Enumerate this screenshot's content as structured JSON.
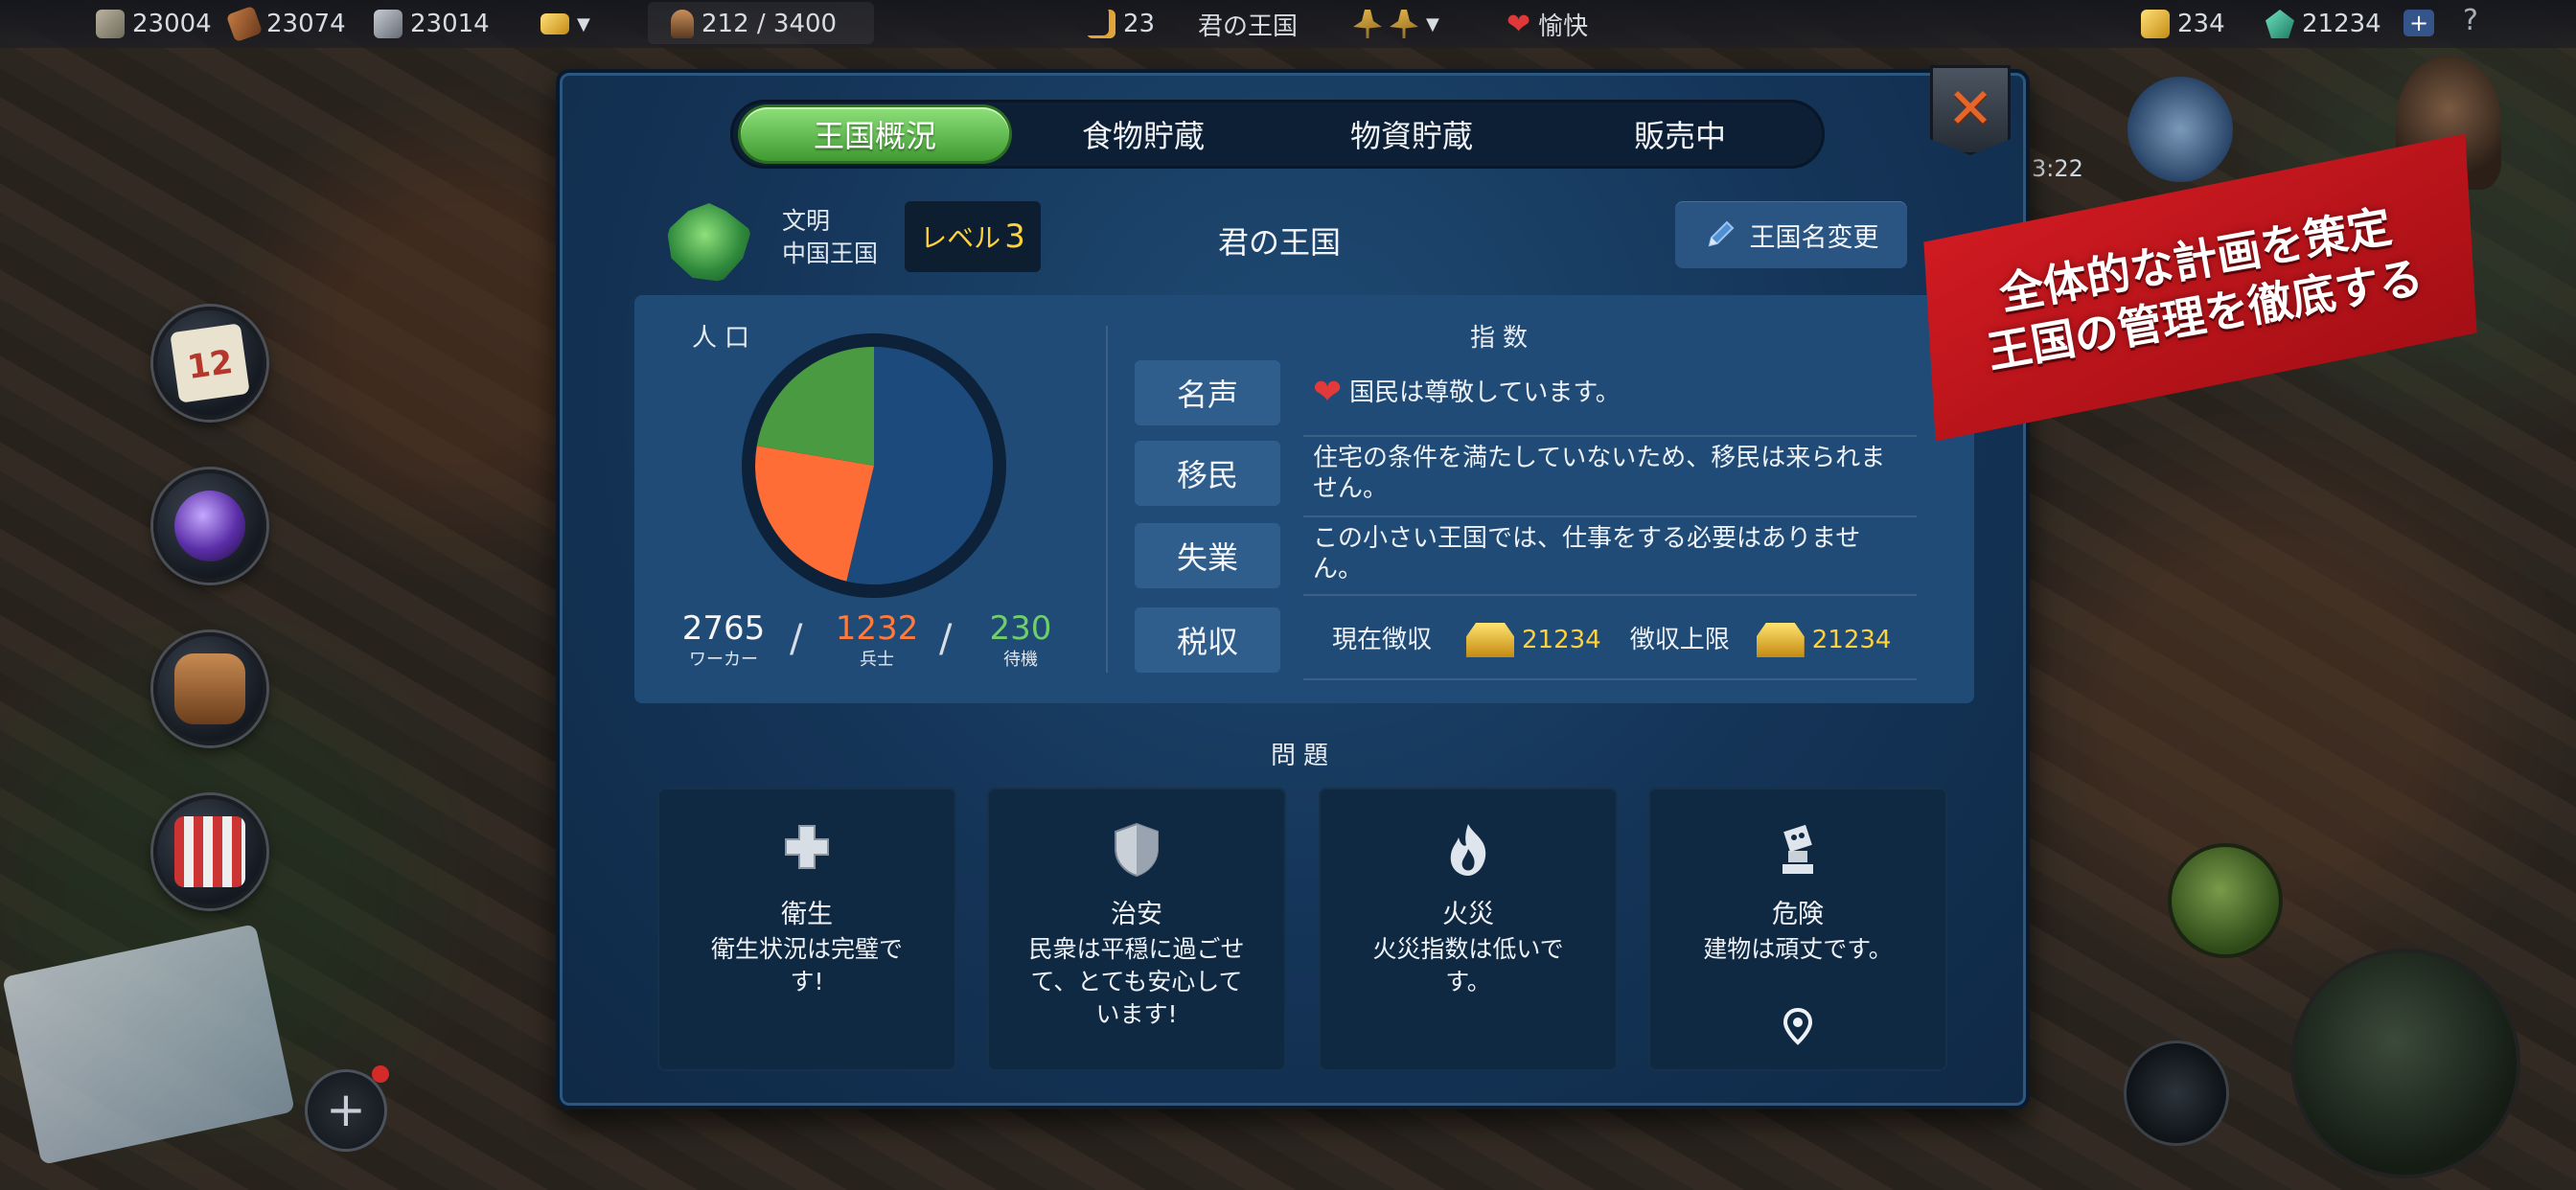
{
  "topbar": {
    "stone": "23004",
    "wood": "23074",
    "iron": "23014",
    "population": "212 / 3400",
    "turns": "23",
    "kingdom": "君の王国",
    "mood": "愉快",
    "gold": "234",
    "gems": "21234",
    "plus": "+",
    "help": "?"
  },
  "hud": {
    "calendar_day": "12",
    "timer": "3:22",
    "add": "+"
  },
  "promo": {
    "line1": "全体的な計画を策定",
    "line2": "王国の管理を徹底する"
  },
  "tabs": [
    {
      "label": "王国概況",
      "active": true
    },
    {
      "label": "食物貯蔵",
      "active": false
    },
    {
      "label": "物資貯蔵",
      "active": false
    },
    {
      "label": "販売中",
      "active": false
    }
  ],
  "header": {
    "civ_label": "文明",
    "civ_value": "中国王国",
    "level_prefix": "レベル",
    "level": "3",
    "kingdom_name": "君の王国",
    "rename_label": "王国名変更"
  },
  "population": {
    "title": "人口",
    "workers": {
      "value": "2765",
      "label": "ワーカー",
      "color": "#f4f6f9"
    },
    "soldiers": {
      "value": "1232",
      "label": "兵士",
      "color": "#ff7a3c"
    },
    "idle": {
      "value": "230",
      "label": "待機",
      "color": "#6fd06a"
    },
    "slash": "/"
  },
  "index": {
    "title": "指数",
    "rows": [
      {
        "label": "名声",
        "text": "国民は尊敬しています。"
      },
      {
        "label": "移民",
        "text": "住宅の条件を満たしていないため、移民は来られません。"
      },
      {
        "label": "失業",
        "text": "この小さい王国では、仕事をする必要はありません。"
      },
      {
        "label": "税収",
        "current_label": "現在徴収",
        "current_value": "21234",
        "max_label": "徴収上限",
        "max_value": "21234"
      }
    ]
  },
  "problems": {
    "title": "問題",
    "cards": [
      {
        "name": "衛生",
        "desc": "衛生状況は完璧です!",
        "icon": "cross-icon"
      },
      {
        "name": "治安",
        "desc": "民衆は平穏に過ごせて、とても安心しています!",
        "icon": "shield-icon"
      },
      {
        "name": "火災",
        "desc": "火災指数は低いです。",
        "icon": "fire-icon"
      },
      {
        "name": "危険",
        "desc": "建物は頑丈です。",
        "icon": "hazard-icon"
      }
    ]
  },
  "colors": {
    "pie_workers": "#1d4a7c",
    "pie_soldiers": "#ff6d37",
    "pie_idle": "#4a9a42",
    "tab_active": "#4fae3d",
    "gold_text": "#ffd13b"
  }
}
